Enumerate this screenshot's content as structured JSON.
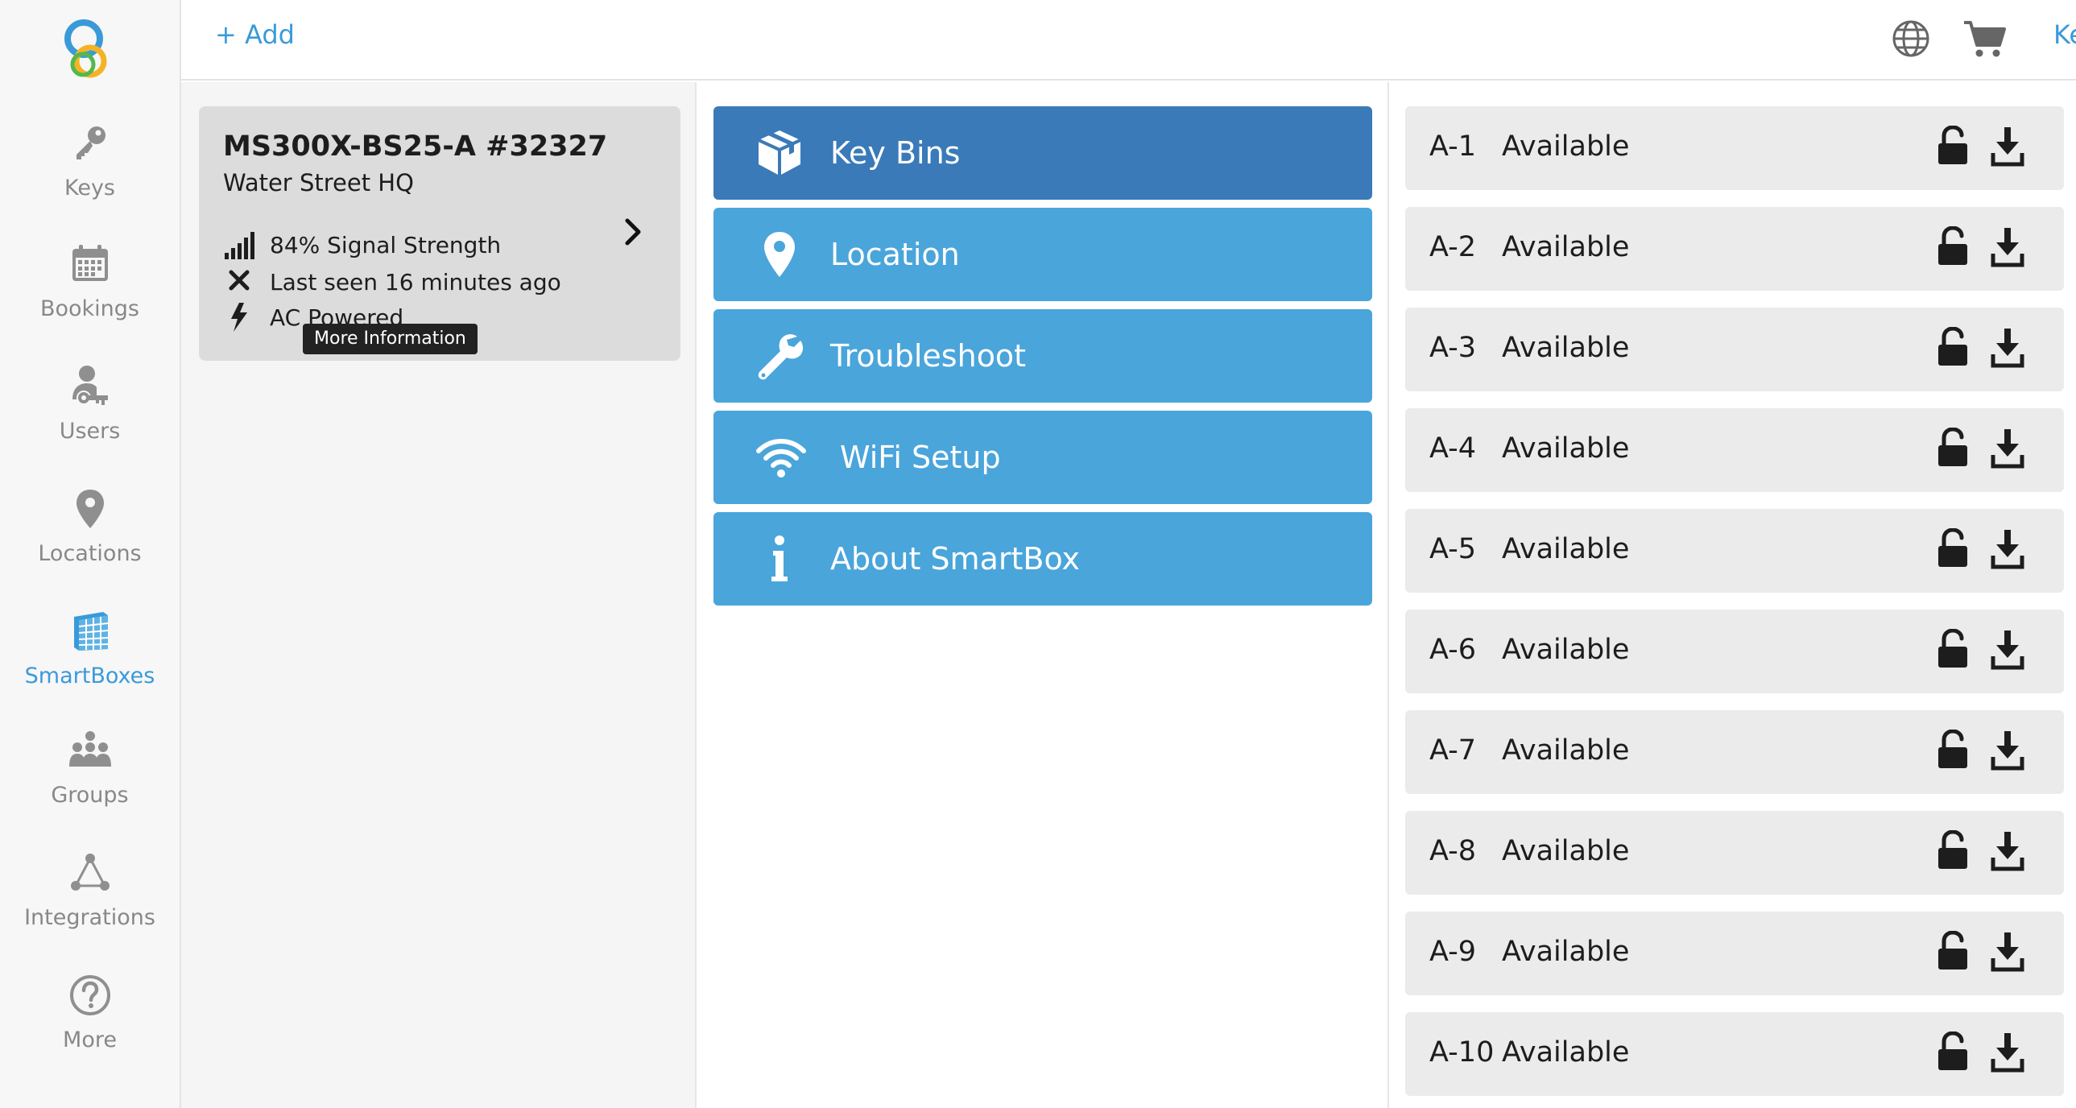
{
  "sidebar": {
    "items": [
      {
        "label": "Keys",
        "icon": "key-icon",
        "active": false
      },
      {
        "label": "Bookings",
        "icon": "calendar-icon",
        "active": false
      },
      {
        "label": "Users",
        "icon": "user-key-icon",
        "active": false
      },
      {
        "label": "Locations",
        "icon": "map-pin-icon",
        "active": false
      },
      {
        "label": "SmartBoxes",
        "icon": "smartbox-icon",
        "active": true
      },
      {
        "label": "Groups",
        "icon": "groups-icon",
        "active": false
      },
      {
        "label": "Integrations",
        "icon": "integrations-icon",
        "active": false
      },
      {
        "label": "More",
        "icon": "question-icon",
        "active": false
      }
    ]
  },
  "topbar": {
    "add_label": "+ Add",
    "user_label": "Ke"
  },
  "device": {
    "name": "MS300X-BS25-A #32327",
    "location": "Water Street HQ",
    "signal": "84% Signal Strength",
    "last_seen": "Last seen 16 minutes ago",
    "power": "AC Powered",
    "tooltip": "More Information"
  },
  "menu": {
    "items": [
      {
        "label": "Key Bins",
        "icon": "box-icon",
        "active": true
      },
      {
        "label": "Location",
        "icon": "map-pin-icon",
        "active": false
      },
      {
        "label": "Troubleshoot",
        "icon": "wrench-icon",
        "active": false
      },
      {
        "label": "WiFi Setup",
        "icon": "wifi-icon",
        "active": false
      },
      {
        "label": "About SmartBox",
        "icon": "info-icon",
        "active": false
      }
    ]
  },
  "bins": [
    {
      "id": "A-1",
      "status": "Available"
    },
    {
      "id": "A-2",
      "status": "Available"
    },
    {
      "id": "A-3",
      "status": "Available"
    },
    {
      "id": "A-4",
      "status": "Available"
    },
    {
      "id": "A-5",
      "status": "Available"
    },
    {
      "id": "A-6",
      "status": "Available"
    },
    {
      "id": "A-7",
      "status": "Available"
    },
    {
      "id": "A-8",
      "status": "Available"
    },
    {
      "id": "A-9",
      "status": "Available"
    },
    {
      "id": "A-10",
      "status": "Available"
    }
  ],
  "colors": {
    "accent": "#3a9ad9",
    "menu_button": "#4aa5db",
    "menu_button_active": "#3a7ab8",
    "bin_row": "#ebebeb",
    "device_card": "#dcdcdc"
  }
}
